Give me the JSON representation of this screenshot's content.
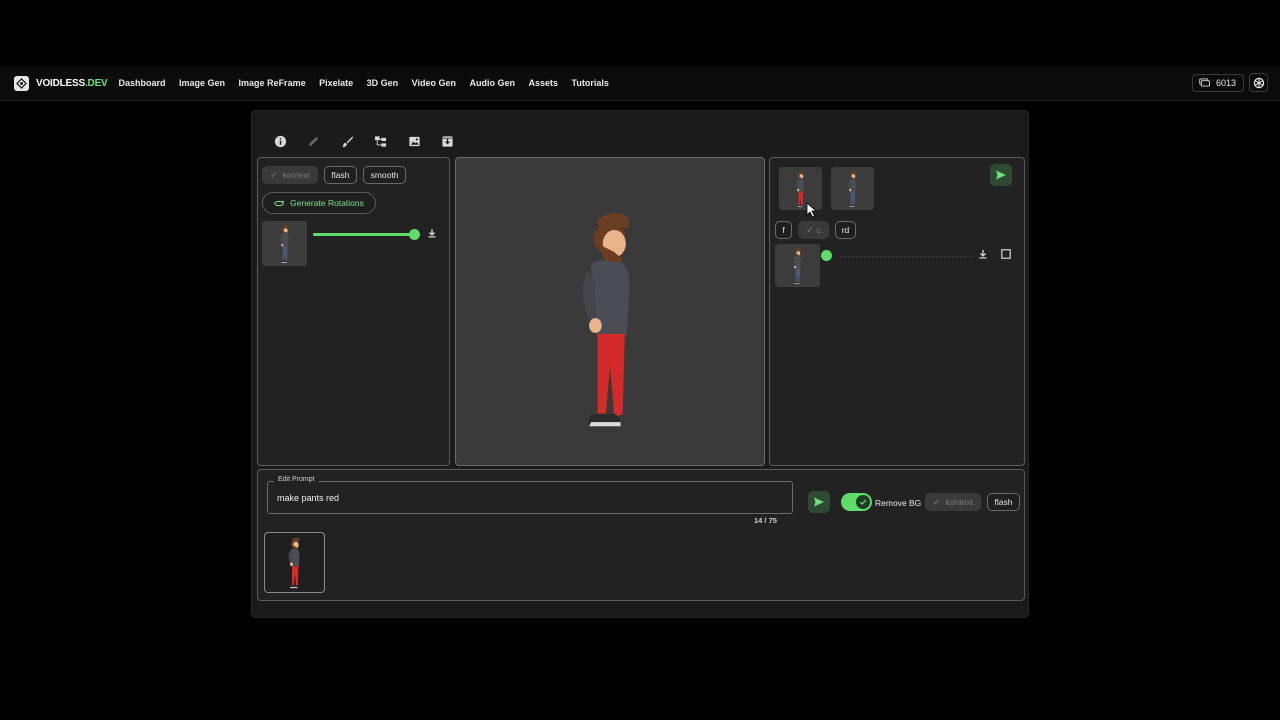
{
  "brand": {
    "name_main": "VOIDLESS",
    "name_suffix": ".DEV"
  },
  "nav": {
    "links": [
      "Dashboard",
      "Image Gen",
      "Image ReFrame",
      "Pixelate",
      "3D Gen",
      "Video Gen",
      "Audio Gen",
      "Assets",
      "Tutorials"
    ],
    "credits": "6013",
    "credits_icon": "coins-icon",
    "user_icon": "openai-logo-icon"
  },
  "toolbar": {
    "tools": [
      "info-icon",
      "pencil-icon",
      "brush-icon",
      "hierarchy-icon",
      "image-icon",
      "archive-icon"
    ]
  },
  "left_panel": {
    "chips": [
      "kontext",
      "flash",
      "smooth"
    ],
    "generate_rotations_label": "Generate Rotations",
    "slider_value": 1.0
  },
  "right_panel": {
    "chips": [
      "f",
      "c",
      "rd"
    ],
    "slider_value": 0.0
  },
  "prompt": {
    "legend": "Edit Prompt",
    "value": "make pants red",
    "char_count": "14 / 75"
  },
  "options": {
    "remove_bg_label": "Remove BG",
    "remove_bg_enabled": true,
    "kontext_label": "kontext",
    "flash_label": "flash"
  },
  "colors": {
    "accent": "#5fdc69",
    "pants_red": "#d42a2a",
    "pants_blue": "#4a5a78",
    "hoodie": "#4a4d55",
    "panel_bg": "#222222"
  }
}
